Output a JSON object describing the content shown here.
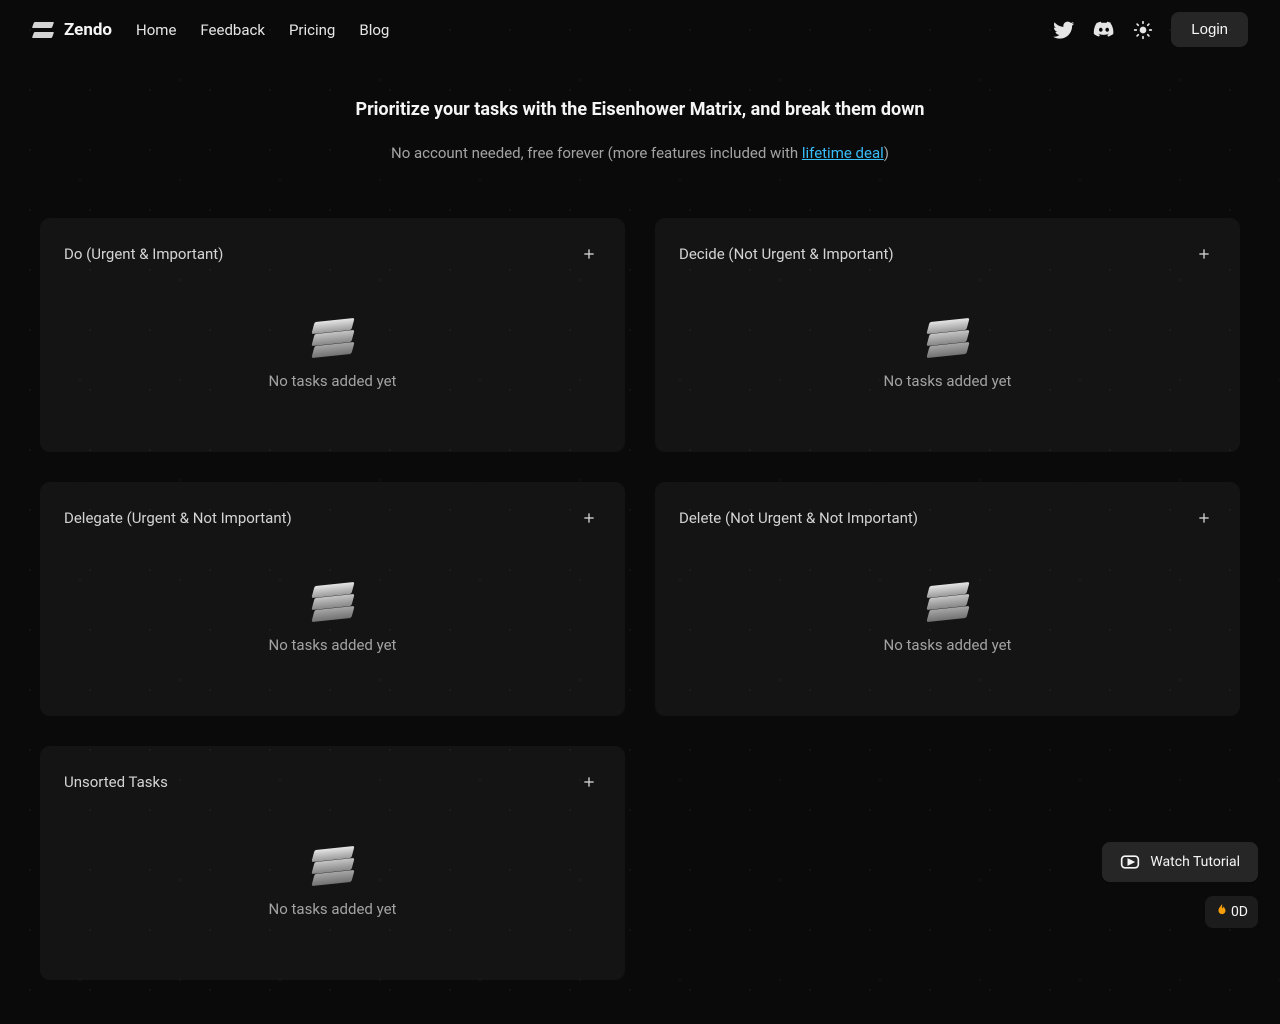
{
  "brand": "Zendo",
  "nav": {
    "home": "Home",
    "feedback": "Feedback",
    "pricing": "Pricing",
    "blog": "Blog"
  },
  "login_label": "Login",
  "hero": {
    "title": "Prioritize your tasks with the Eisenhower Matrix, and break them down",
    "sub_prefix": "No account needed, free forever (more features included with ",
    "link": "lifetime deal",
    "sub_suffix": ")"
  },
  "cards": {
    "do": {
      "title": "Do (Urgent & Important)",
      "empty": "No tasks added yet"
    },
    "decide": {
      "title": "Decide (Not Urgent & Important)",
      "empty": "No tasks added yet"
    },
    "delegate": {
      "title": "Delegate (Urgent & Not Important)",
      "empty": "No tasks added yet"
    },
    "delete": {
      "title": "Delete (Not Urgent & Not Important)",
      "empty": "No tasks added yet"
    },
    "unsorted": {
      "title": "Unsorted Tasks",
      "empty": "No tasks added yet"
    }
  },
  "watch_label": "Watch Tutorial",
  "streak_label": "0D"
}
